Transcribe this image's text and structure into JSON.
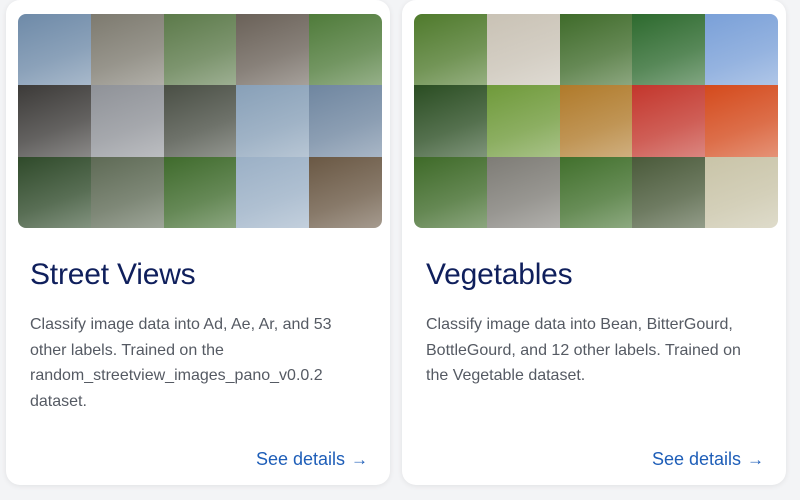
{
  "cards": [
    {
      "title": "Street Views",
      "description": "Classify image data into Ad, Ae, Ar, and 53 other labels. Trained on the random_streetview_images_pano_v0.0.2 dataset.",
      "link_label": "See details",
      "link_arrow": "→",
      "mosaic_colors": [
        "#6e8aa8",
        "#7d7a6f",
        "#5c7a4a",
        "#6a6158",
        "#4f7b3a",
        "#3c3a38",
        "#8f9298",
        "#4a4f45",
        "#88a0b8",
        "#6f86a0",
        "#2f4a2a",
        "#5e6a55",
        "#3f6b2c",
        "#9bb0c6",
        "#6a5844"
      ]
    },
    {
      "title": "Vegetables",
      "description": "Classify image data into Bean, BitterGourd, BottleGourd, and 12 other labels. Trained on the Vegetable dataset.",
      "link_label": "See details",
      "link_arrow": "→",
      "mosaic_colors": [
        "#4f7a2c",
        "#c9c2b5",
        "#3f6b2a",
        "#2d6a2e",
        "#7aa0d8",
        "#2a4d22",
        "#6f9a3a",
        "#b07a2a",
        "#c3362c",
        "#d44a1c",
        "#3e6a28",
        "#7e7c76",
        "#41702c",
        "#4a5a3a",
        "#c9c4a8"
      ]
    }
  ],
  "colors": {
    "title": "#0f1f5c",
    "description": "#555a63",
    "link": "#1e5eb8"
  }
}
